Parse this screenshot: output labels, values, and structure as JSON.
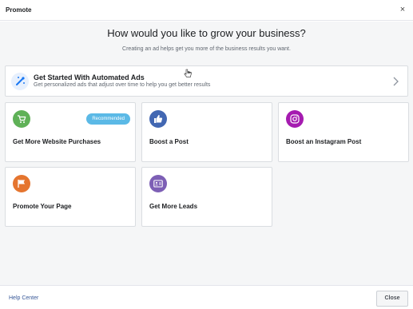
{
  "header": {
    "title": "Promote",
    "close_glyph": "×"
  },
  "main": {
    "heading": "How would you like to grow your business?",
    "subheading": "Creating an ad helps get you more of the business results you want."
  },
  "automated": {
    "title": "Get Started With Automated Ads",
    "subtitle": "Get personalized ads that adjust over time to help you get better results",
    "icon": "magic-wand-icon",
    "chevron": "chevron-right-icon"
  },
  "options": [
    {
      "label": "Get More Website Purchases",
      "icon": "shopping-cart-icon",
      "color": "#5fb157",
      "badge": "Recommended"
    },
    {
      "label": "Boost a Post",
      "icon": "thumbs-up-icon",
      "color": "#4267b2"
    },
    {
      "label": "Boost an Instagram Post",
      "icon": "instagram-icon",
      "color": "#a51bb0"
    },
    {
      "label": "Promote Your Page",
      "icon": "flag-icon",
      "color": "#e5752f"
    },
    {
      "label": "Get More Leads",
      "icon": "contact-card-icon",
      "color": "#7d5fb5"
    }
  ],
  "footer": {
    "help_link": "Help Center",
    "close_label": "Close"
  },
  "colors": {
    "badge": "#5bb9e6",
    "link": "#385898",
    "auto_icon_bg": "#e7f0fd"
  }
}
